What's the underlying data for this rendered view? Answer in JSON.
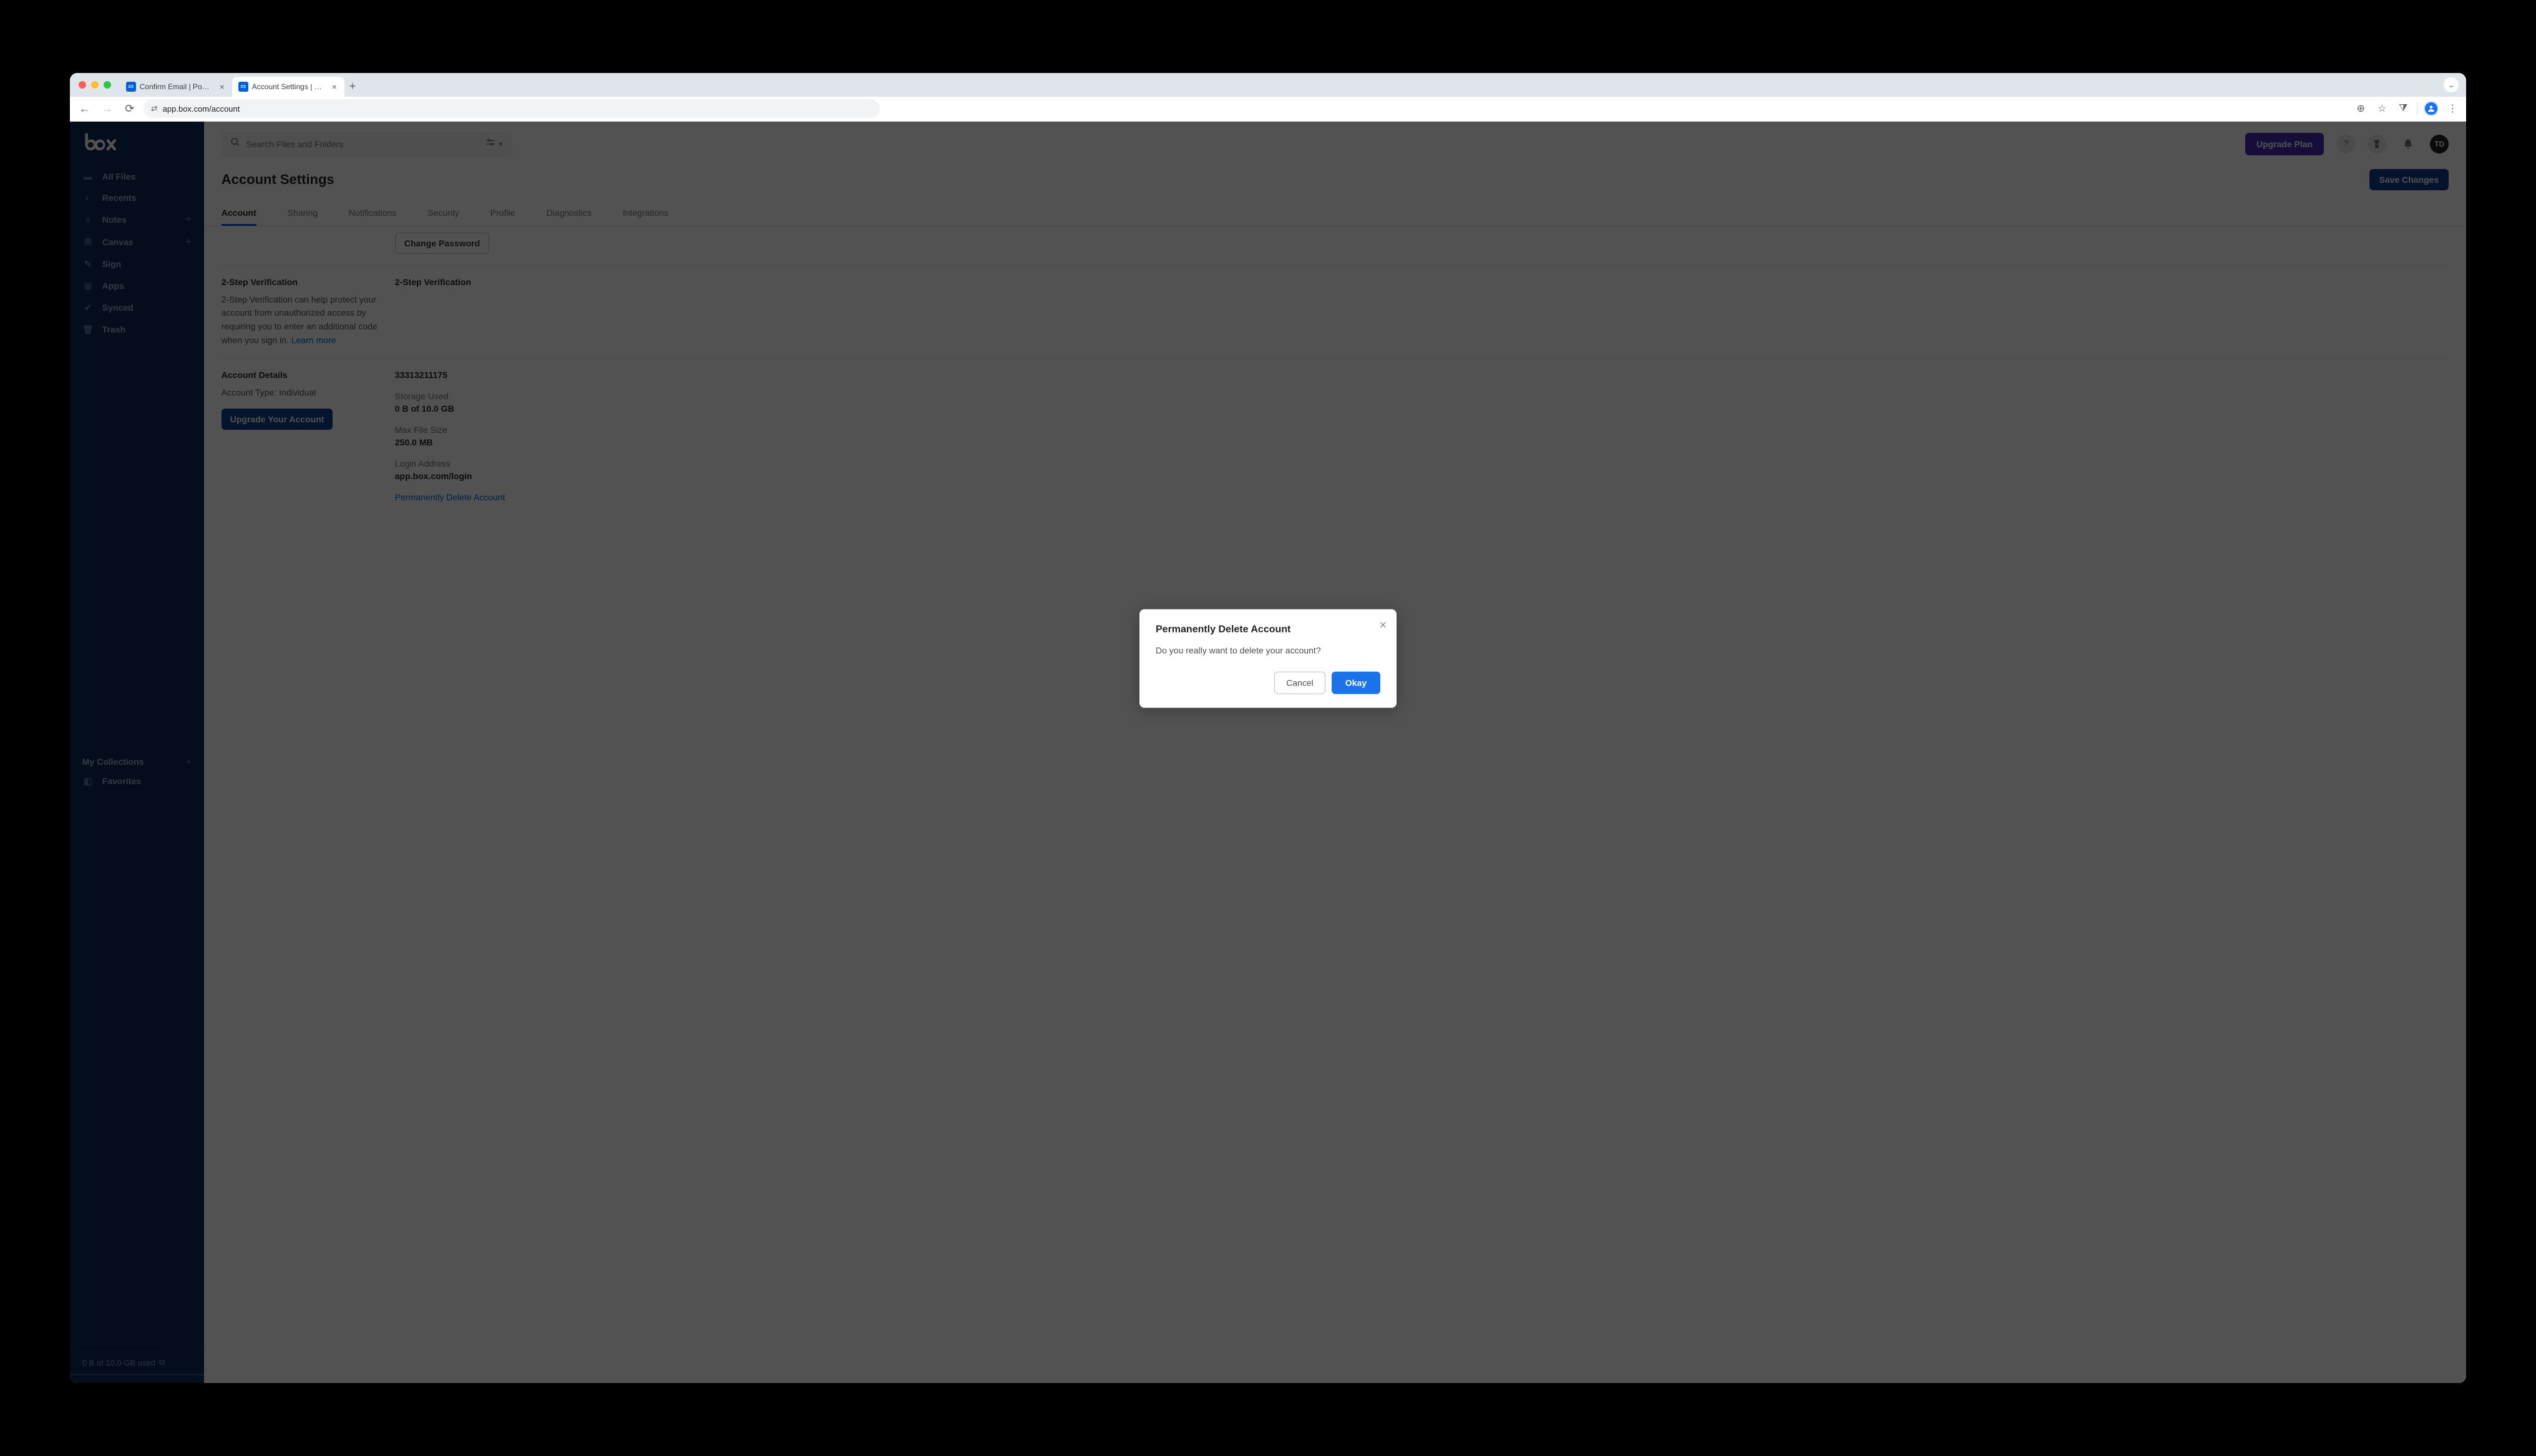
{
  "browser": {
    "tabs": [
      {
        "title": "Confirm Email | Powered by B",
        "active": false
      },
      {
        "title": "Account Settings | Powered",
        "active": true
      }
    ],
    "url": "app.box.com/account"
  },
  "sidebar": {
    "items": [
      {
        "label": "All Files"
      },
      {
        "label": "Recents"
      },
      {
        "label": "Notes"
      },
      {
        "label": "Canvas"
      },
      {
        "label": "Sign"
      },
      {
        "label": "Apps"
      },
      {
        "label": "Synced"
      },
      {
        "label": "Trash"
      }
    ],
    "collections_label": "My Collections",
    "favorites_label": "Favorites",
    "storage": "0 B of 10.0 GB used"
  },
  "header": {
    "search_placeholder": "Search Files and Folders",
    "upgrade": "Upgrade Plan",
    "avatar": "TD"
  },
  "page": {
    "title": "Account Settings",
    "save": "Save Changes",
    "tabs": [
      "Account",
      "Sharing",
      "Notifications",
      "Security",
      "Profile",
      "Diagnostics",
      "Integrations"
    ]
  },
  "settings": {
    "change_password": "Change Password",
    "two_step": {
      "heading": "2-Step Verification",
      "desc": "2-Step Verification can help protect your account from unauthorized access by requiring you to enter an additional code when you sign in. ",
      "learn_more": "Learn more",
      "right_heading": "2-Step Verification"
    },
    "account_details": {
      "heading": "Account Details",
      "account_type": "Account Type: Individual",
      "upgrade": "Upgrade Your Account",
      "account_id_value": "33313211175",
      "storage_label": "Storage Used",
      "storage_value": "0 B of 10.0 GB",
      "max_file_label": "Max File Size",
      "max_file_value": "250.0 MB",
      "login_label": "Login Address",
      "login_value": "app.box.com/login",
      "delete_link": "Permanently Delete Account"
    }
  },
  "modal": {
    "title": "Permanently Delete Account",
    "body": "Do you really want to delete your account?",
    "cancel": "Cancel",
    "okay": "Okay"
  }
}
